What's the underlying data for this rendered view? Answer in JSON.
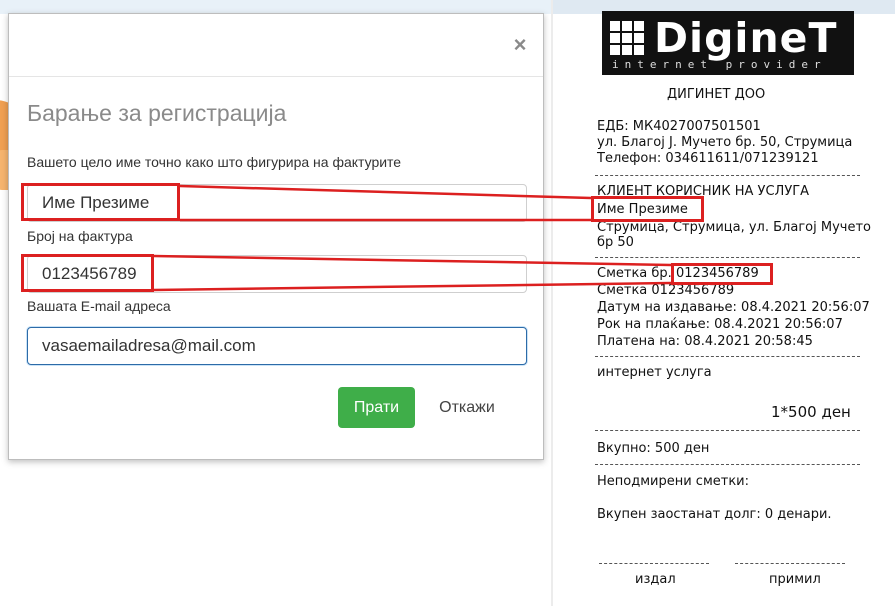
{
  "modal": {
    "close_label": "×",
    "title": "Барање за регистрација",
    "name_label": "Вашето цело име точно како што фигурира на фактурите",
    "name_value": "Име Презиме",
    "invoice_label": "Број на фактура",
    "invoice_value": "0123456789",
    "email_label": "Вашата E-mail адреса",
    "email_value": "vasaemailadresa@mail.com",
    "submit_label": "Прати",
    "cancel_label": "Откажи"
  },
  "receipt": {
    "logo_text": "DigineT",
    "logo_sub": "internet provider",
    "company": "ДИГИНЕТ ДОО",
    "edb": "ЕДБ: МК4027007501501",
    "address": "ул. Благој Ј. Мучето бр. 50, Струмица",
    "phone": "Телефон: 034611611/071239121",
    "client_header": "КЛИЕНТ КОРИСНИК НА УСЛУГА",
    "client_name": "Име Презиме",
    "client_address_1": "Струмица, Струмица, ул. Благој Мучето",
    "client_address_2": "бр 50",
    "invoice_prefix": "Сметка бр.",
    "invoice_no": "0123456789",
    "invoice_line2": "Сметка 0123456789",
    "issued": "Датум на издавање: 08.4.2021 20:56:07",
    "due": "Рок на плаќање: 08.4.2021 20:56:07",
    "paid": "Платена на:  08.4.2021 20:58:45",
    "service": "интернет услуга",
    "quantity_price": "1*500 ден",
    "total": "Вкупно: 500 ден",
    "unpaid": "Неподмирени сметки:",
    "debt": "Вкупен заостанат долг: 0 денари.",
    "issued_by": "издал",
    "received_by": "примил"
  },
  "colors": {
    "highlight": "#dc2020",
    "submit": "#3fae49",
    "focus_border": "#2d6ba8"
  }
}
